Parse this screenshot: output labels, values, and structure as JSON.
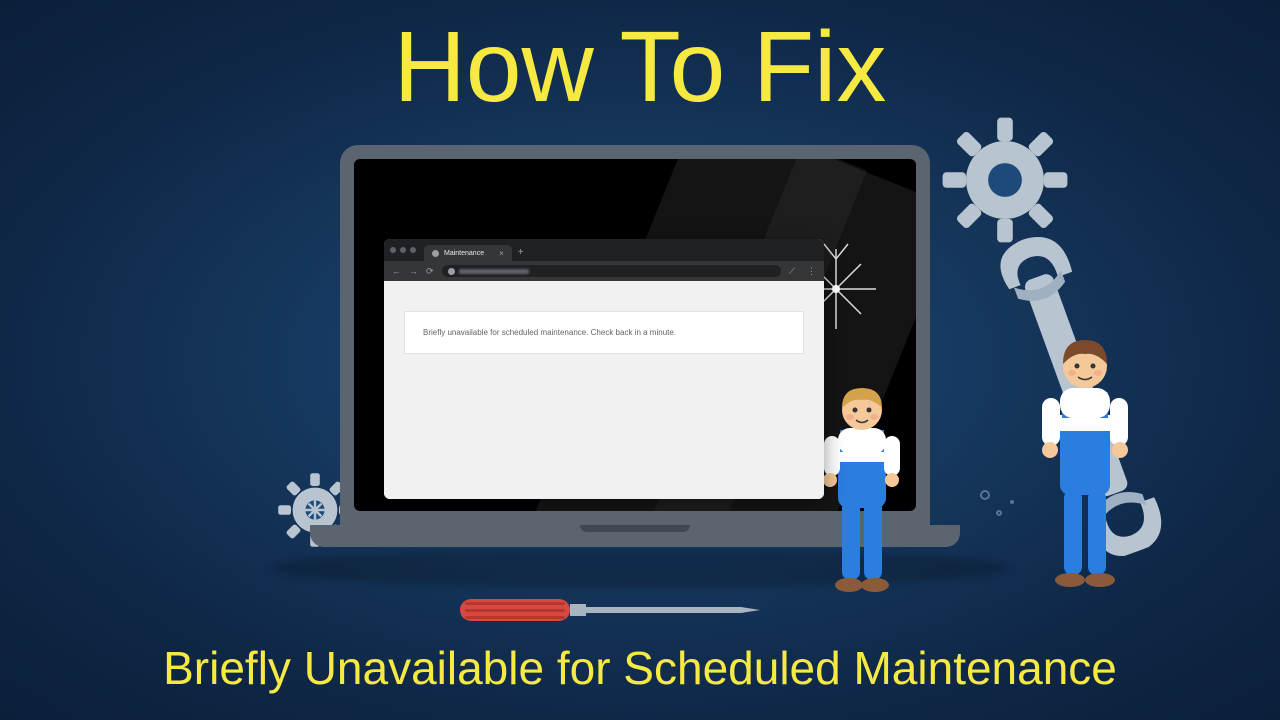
{
  "title": "How To Fix",
  "subtitle": "Briefly Unavailable for Scheduled Maintenance",
  "browser": {
    "tab_label": "Maintenance",
    "content_message": "Briefly unavailable for scheduled maintenance. Check back in a minute."
  }
}
